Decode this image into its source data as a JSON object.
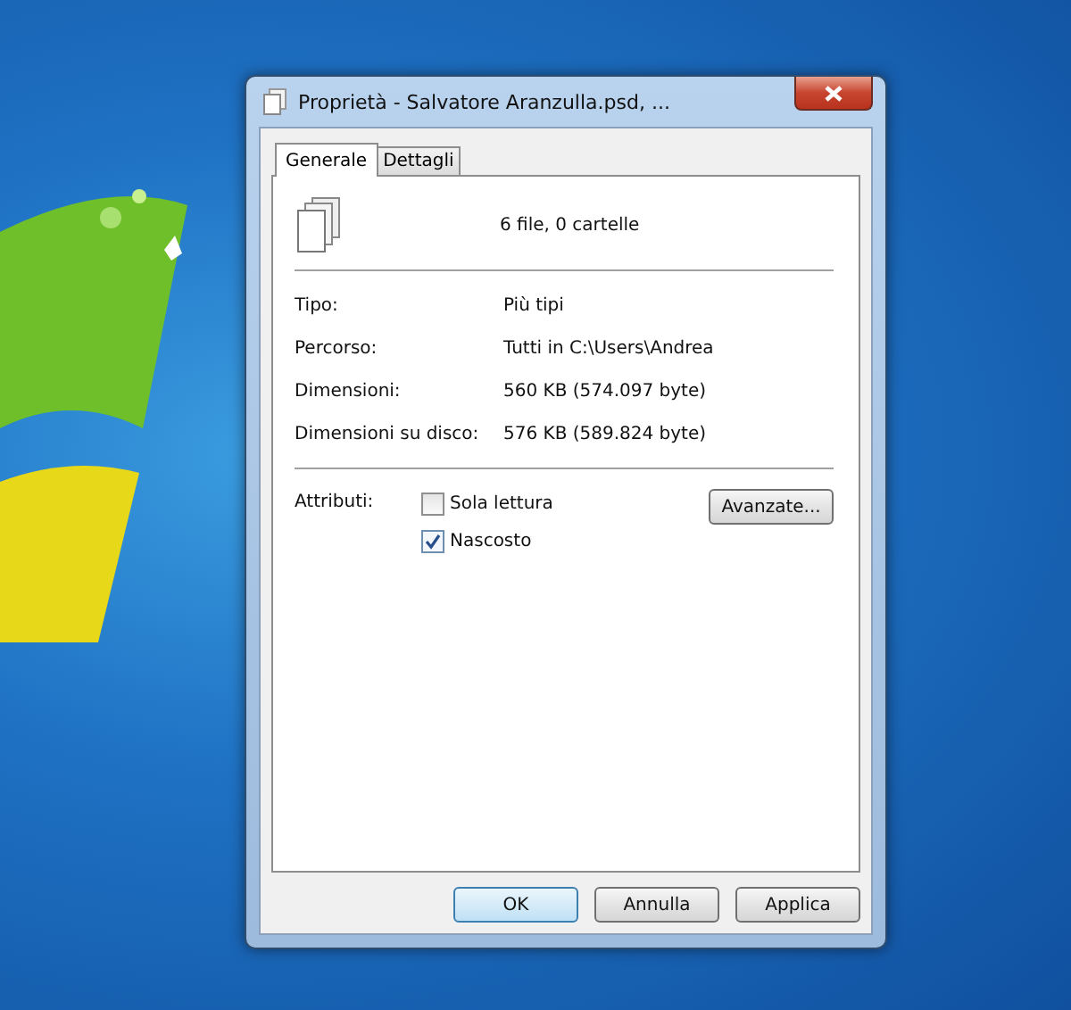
{
  "window": {
    "title": "Proprietà - Salvatore Aranzulla.psd, ..."
  },
  "tabs": [
    {
      "label": "Generale",
      "selected": true
    },
    {
      "label": "Dettagli",
      "selected": false
    }
  ],
  "summary": "6 file, 0 cartelle",
  "properties": [
    {
      "label": "Tipo:",
      "value": "Più tipi"
    },
    {
      "label": "Percorso:",
      "value": "Tutti in C:\\Users\\Andrea"
    },
    {
      "label": "Dimensioni:",
      "value": "560 KB (574.097 byte)"
    },
    {
      "label": "Dimensioni su disco:",
      "value": "576 KB (589.824 byte)"
    }
  ],
  "attributes": {
    "label": "Attributi:",
    "advanced_button": "Avanzate...",
    "options": [
      {
        "label": "Sola lettura",
        "checked": false
      },
      {
        "label": "Nascosto",
        "checked": true
      }
    ]
  },
  "buttons": [
    {
      "label": "OK",
      "default": true
    },
    {
      "label": "Annulla",
      "default": false
    },
    {
      "label": "Applica",
      "default": false
    }
  ]
}
